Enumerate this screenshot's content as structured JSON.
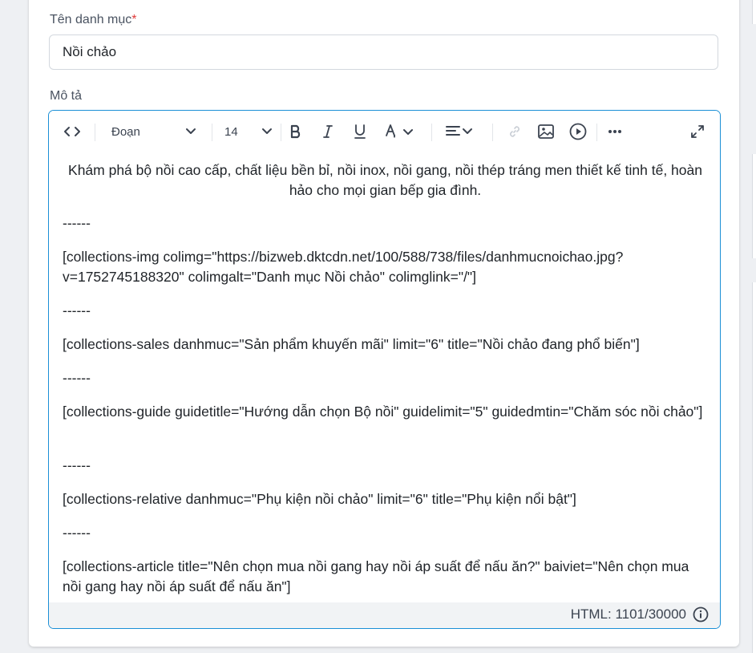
{
  "form": {
    "name_label": "Tên danh mục",
    "required_mark": "*",
    "name_value": "Nồi chảo",
    "description_label": "Mô tả"
  },
  "toolbar": {
    "block_format": "Đoạn",
    "font_size": "14",
    "icons": [
      "code-view-icon",
      "chevron-down-icon",
      "bold-icon",
      "italic-icon",
      "underline-icon",
      "text-color-icon",
      "align-icon",
      "link-icon",
      "image-icon",
      "video-icon",
      "more-icon",
      "fullscreen-icon"
    ]
  },
  "content": {
    "intro": "Khám phá bộ nồi cao cấp, chất liệu bền bỉ, nồi inox, nồi gang, nồi thép tráng men thiết kế tinh tế, hoàn hảo cho mọi gian bếp gia đình.",
    "separator": "------",
    "img_shortcode": "[collections-img colimg=\"https://bizweb.dktcdn.net/100/588/738/files/danhmucnoichao.jpg?v=1752745188320\" colimgalt=\"Danh mục Nồi chảo\" colimglink=\"/\"]",
    "sales_shortcode": "[collections-sales danhmuc=\"Sản phẩm khuyến mãi\" limit=\"6\" title=\"Nồi chảo đang phổ biến\"]",
    "guide_shortcode": "[collections-guide guidetitle=\"Hướng dẫn chọn Bộ nồi\" guidelimit=\"5\" guidedmtin=\"Chăm sóc nồi chảo\"]",
    "relative_shortcode": "[collections-relative danhmuc=\"Phụ kiện nồi chảo\" limit=\"6\" title=\"Phụ kiện nổi bật\"]",
    "article_shortcode": "[collections-article title=\"Nên chọn mua nồi gang hay nồi áp suất để nấu ăn?\" baiviet=\"Nên chọn mua nồi gang hay nồi áp suất để nấu ăn\"]"
  },
  "footer": {
    "counter": "HTML: 1101/30000"
  },
  "colors": {
    "accent": "#1a8fd6",
    "required": "#e03b3b"
  }
}
